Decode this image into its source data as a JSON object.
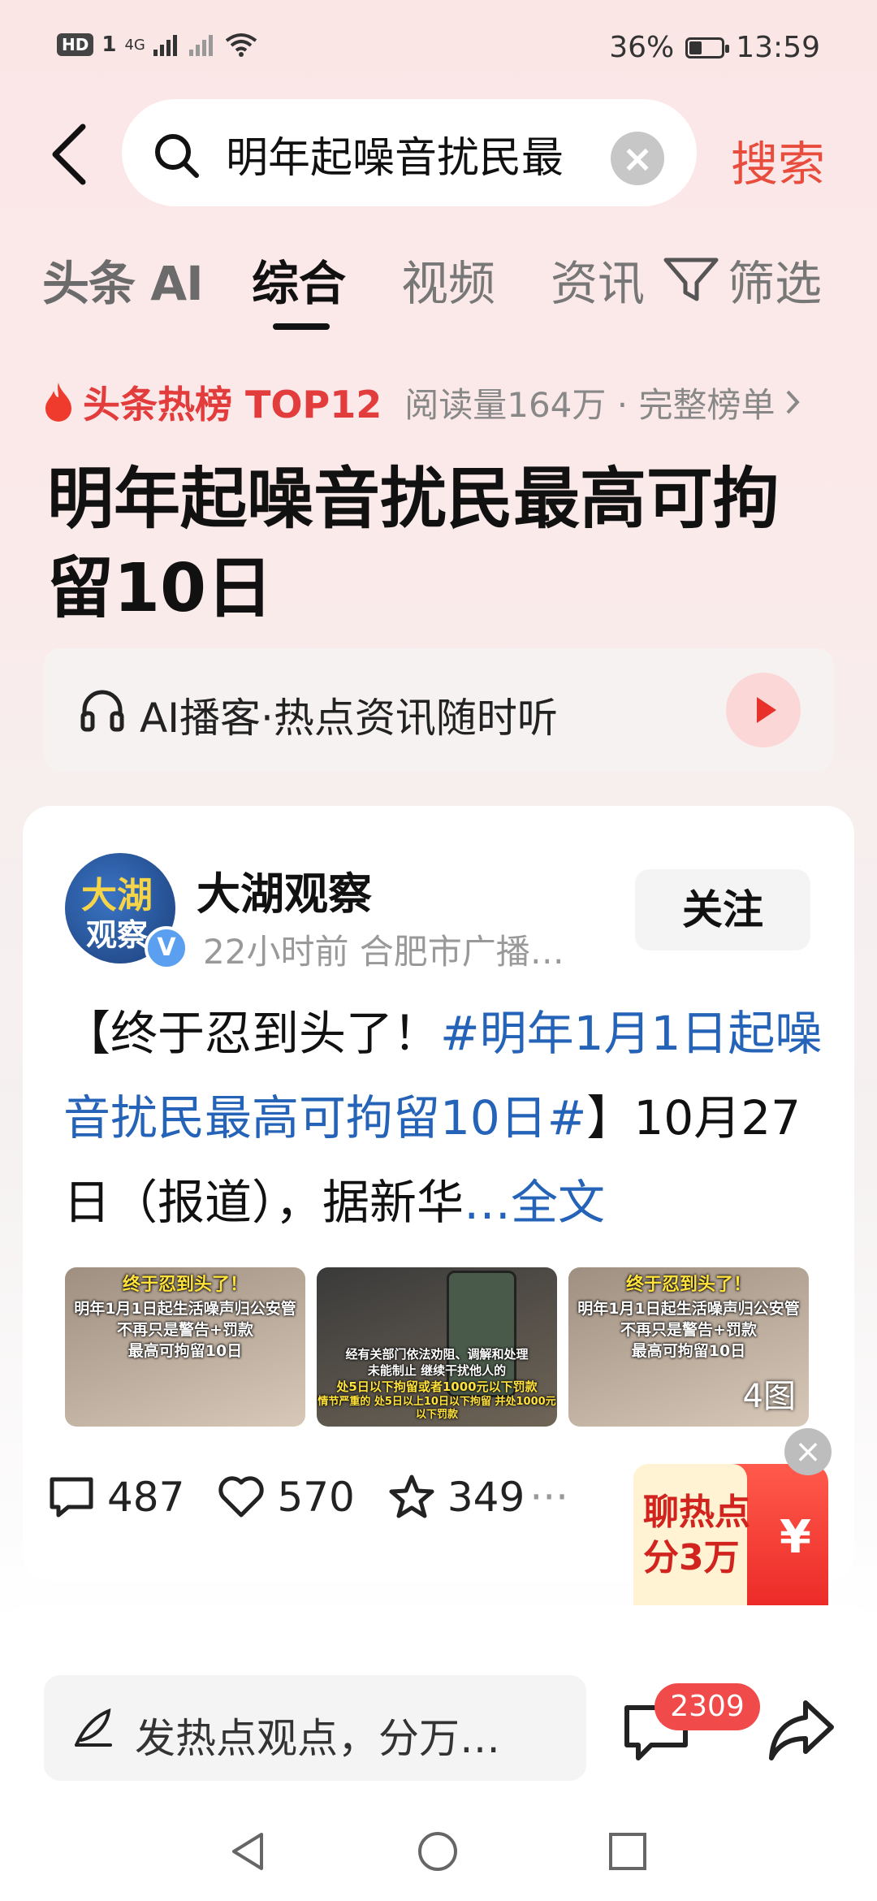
{
  "status_bar": {
    "network": "4G",
    "hd": "HD",
    "sim": "1",
    "battery": "36%",
    "time": "13:59"
  },
  "search": {
    "query": "明年起噪音扰民最",
    "button_label": "搜索"
  },
  "tabs": [
    {
      "label": "头条 AI"
    },
    {
      "label": "综合",
      "active": true
    },
    {
      "label": "视频"
    },
    {
      "label": "资讯"
    },
    {
      "label": "筛选"
    }
  ],
  "hot": {
    "rank_label": "头条热榜 TOP12",
    "meta": "阅读量164万 · 完整榜单"
  },
  "headline": "明年起噪音扰民最高可拘留10日",
  "podcast": {
    "label": "AI播客·热点资讯随时听"
  },
  "card": {
    "avatar_text_top": "大湖",
    "avatar_text_bottom": "观察",
    "author": "大湖观察",
    "meta": "22小时前  合肥市广播…",
    "follow_label": "关注",
    "post_prefix": "【终于忍到头了！",
    "post_tag": "#明年1月1日起噪音扰民最高可拘留10日#",
    "post_suffix": "】10月27日（报道），据新华",
    "post_more": "…全文",
    "thumbnails": [
      {
        "line1": "终于忍到头了！",
        "line2": "明年1月1日起生活噪声归公安管",
        "line3": "不再只是警告+罚款",
        "line4": "最高可拘留10日"
      },
      {
        "line1": "经有关部门依法劝阻、调解和处理",
        "line2": "未能制止 继续干扰他人的",
        "line3": "处5日以下拘留或者1000元以下罚款",
        "line4": "情节严重的 处5日以上10日以下拘留 并处1000元以下罚款"
      },
      {
        "line1": "终于忍到头了！",
        "line2": "明年1月1日起生活噪声归公安管",
        "line3": "不再只是警告+罚款",
        "line4": "最高可拘留10日",
        "count": "4图"
      }
    ],
    "comments": "487",
    "likes": "570",
    "favorites": "349"
  },
  "red_packet": {
    "line1": "聊热点",
    "line2": "分3万",
    "yen": "¥"
  },
  "bottom": {
    "input_placeholder": "发热点观点，分万…",
    "comment_badge": "2309"
  }
}
